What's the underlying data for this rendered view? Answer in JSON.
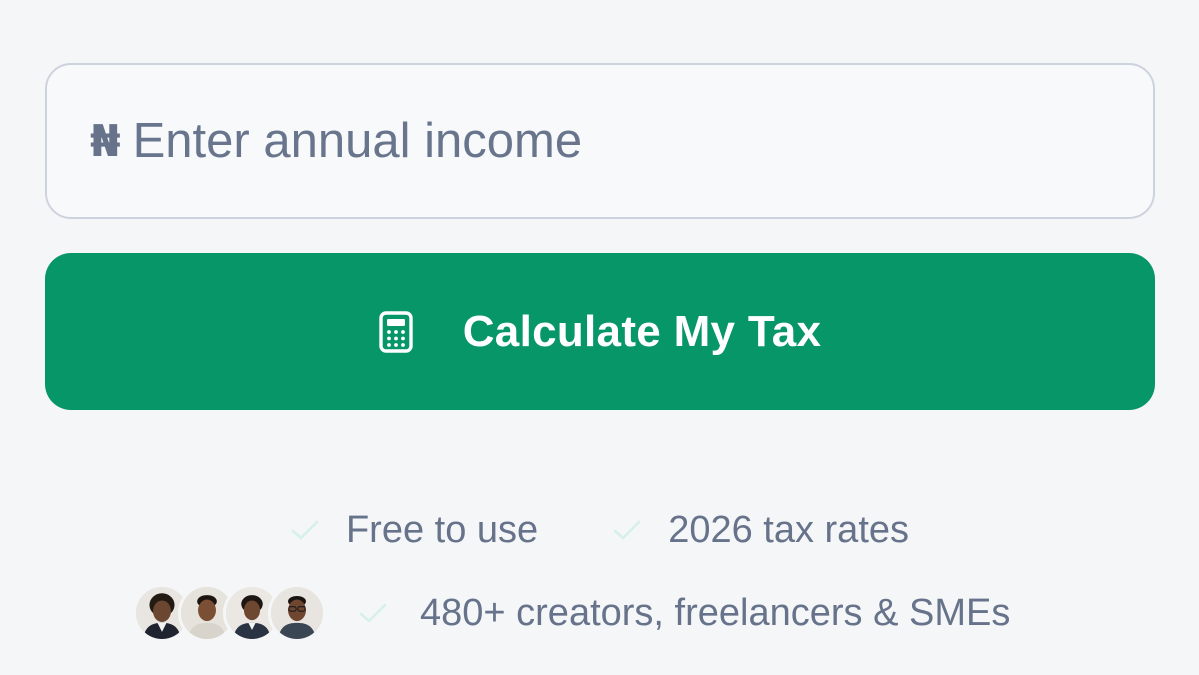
{
  "income": {
    "currency_symbol": "₦",
    "placeholder": "Enter annual income",
    "value": ""
  },
  "calculate_button": {
    "label": "Calculate My Tax",
    "icon": "calculator-icon",
    "color": "#069668"
  },
  "features": [
    {
      "icon": "check-icon",
      "label": "Free to use"
    },
    {
      "icon": "check-icon",
      "label": "2026 tax rates"
    }
  ],
  "social_proof": {
    "avatars": [
      "avatar-1",
      "avatar-2",
      "avatar-3",
      "avatar-4"
    ],
    "icon": "check-icon",
    "label": "480+ creators, freelancers & SMEs"
  },
  "colors": {
    "background": "#f5f6f8",
    "accent": "#069668",
    "muted_text": "#66738a",
    "check": "#d6f1e5"
  }
}
